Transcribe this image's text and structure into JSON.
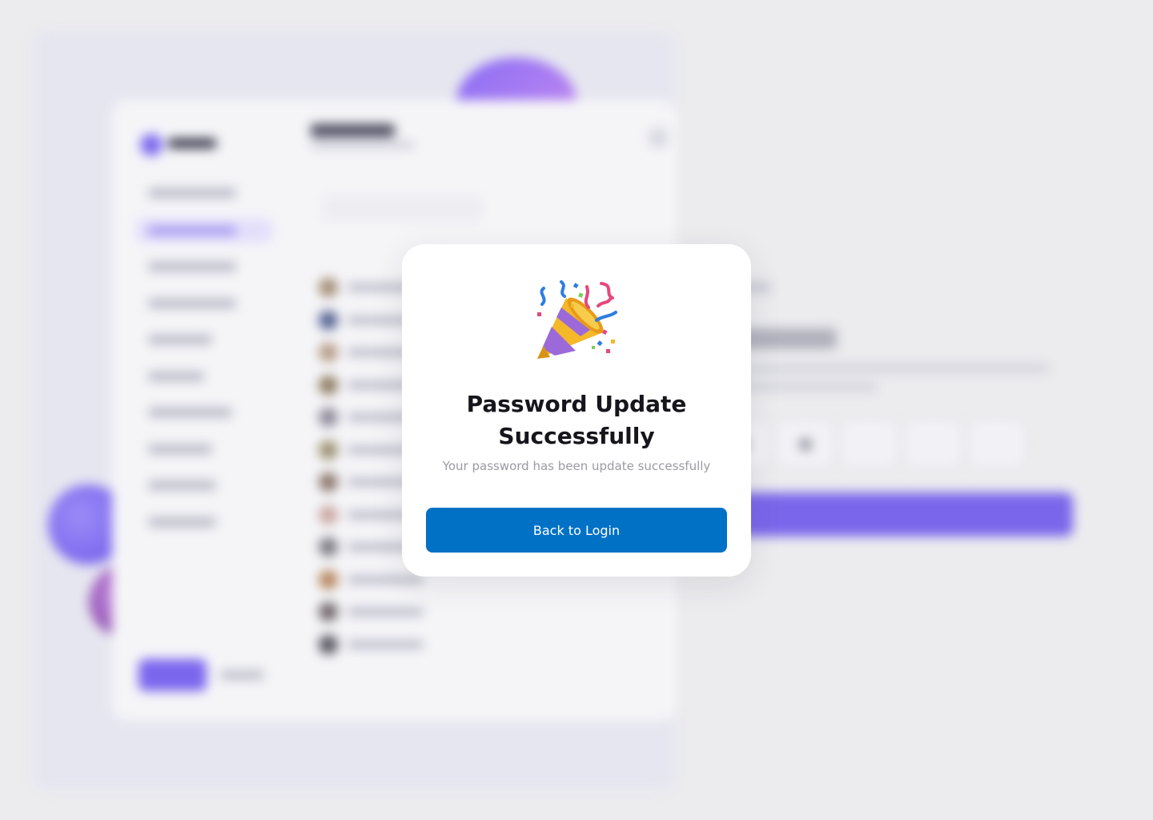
{
  "modal": {
    "icon": "party-popper-icon",
    "title_line1": "Password Update",
    "title_line2": "Successfully",
    "message": "Your password has been update successfully",
    "button_label": "Back to Login"
  },
  "colors": {
    "primary_button": "#0171c5",
    "background": "#ececef",
    "accent_purple": "#7a66ea"
  }
}
